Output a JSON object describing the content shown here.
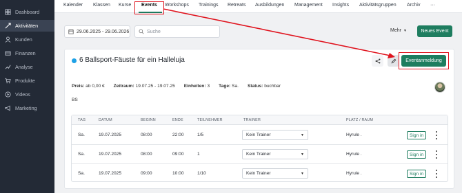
{
  "sidebar": {
    "items": [
      {
        "label": "Dashboard",
        "icon": "dashboard-icon"
      },
      {
        "label": "Aktivitäten",
        "icon": "activity-icon",
        "active": true
      },
      {
        "label": "Kunden",
        "icon": "user-icon"
      },
      {
        "label": "Finanzen",
        "icon": "finance-icon"
      },
      {
        "label": "Analyse",
        "icon": "chart-icon"
      },
      {
        "label": "Produkte",
        "icon": "cart-icon"
      },
      {
        "label": "Videos",
        "icon": "play-icon"
      },
      {
        "label": "Marketing",
        "icon": "megaphone-icon"
      }
    ]
  },
  "tabs": [
    "Kalender",
    "Klassen",
    "Kurse",
    "Events",
    "Workshops",
    "Trainings",
    "Retreats",
    "Ausbildungen",
    "Management",
    "Insights",
    "Aktivitätsgruppen",
    "Archiv",
    "···"
  ],
  "active_tab": "Events",
  "filters": {
    "date_range": "29.06.2025 - 29.06.2026",
    "search_placeholder": "Suche",
    "more_label": "Mehr",
    "new_event_label": "Neues Event"
  },
  "event": {
    "title": "6 Ballsport-Fäuste für ein Halleluja",
    "status_color": "#1ea1e6",
    "register_label": "Eventanmeldung",
    "info": [
      {
        "key": "Preis:",
        "value": "ab 0,00 €"
      },
      {
        "key": "Zeitraum:",
        "value": "19.07.25 - 19.07.25"
      },
      {
        "key": "Einheiten:",
        "value": "3"
      },
      {
        "key": "Tage:",
        "value": "Sa."
      },
      {
        "key": "Status:",
        "value": "buchbar"
      }
    ],
    "description": "BS"
  },
  "table": {
    "headers": [
      "TAG",
      "DATUM",
      "BEGINN",
      "ENDE",
      "TEILNEHMER",
      "TRAINER",
      "PLATZ / RAUM"
    ],
    "rows": [
      {
        "tag": "Sa.",
        "datum": "19.07.2025",
        "beginn": "08:00",
        "ende": "22:00",
        "teilnehmer": "1/5",
        "trainer": "Kein Trainer",
        "platz": "Hyrule .",
        "action": "Sign in"
      },
      {
        "tag": "Sa.",
        "datum": "19.07.2025",
        "beginn": "08:00",
        "ende": "09:00",
        "teilnehmer": "1",
        "trainer": "Kein Trainer",
        "platz": "Hyrule .",
        "action": "Sign in"
      },
      {
        "tag": "Sa.",
        "datum": "19.07.2025",
        "beginn": "09:00",
        "ende": "10:00",
        "teilnehmer": "1/10",
        "trainer": "Kein Trainer",
        "platz": "Hyrule .",
        "action": "Sign in"
      }
    ]
  },
  "colors": {
    "accent": "#1e7d5f",
    "highlight": "#e0141e",
    "sidebar": "#232a36"
  }
}
